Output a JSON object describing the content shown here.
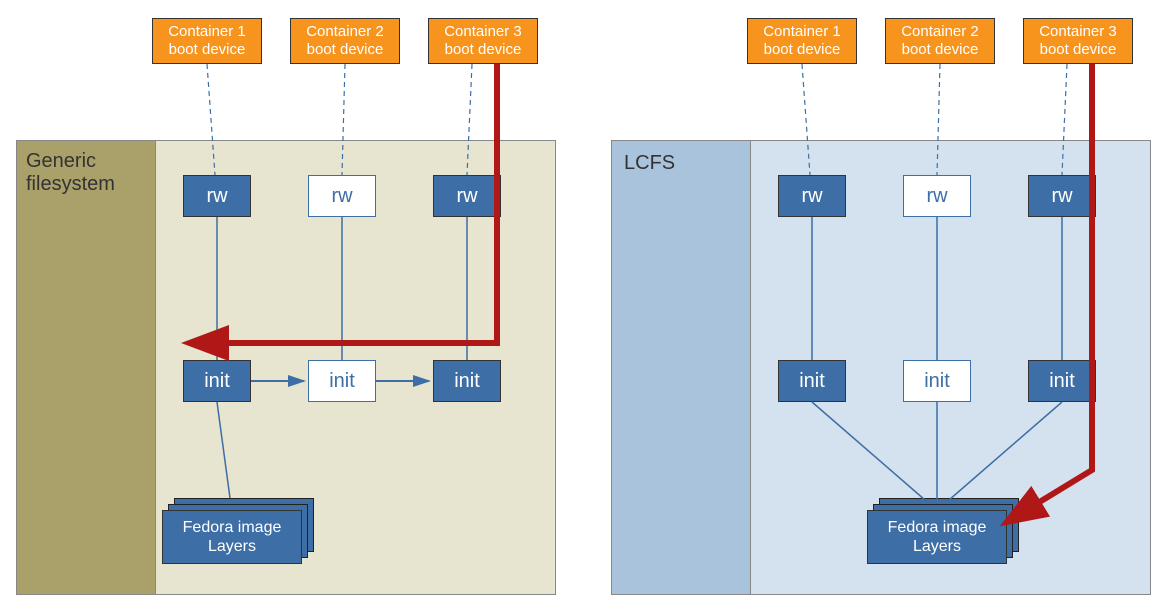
{
  "left": {
    "title": "Generic filesystem",
    "containers": [
      "Container 1 boot device",
      "Container 2 boot device",
      "Container 3 boot device"
    ],
    "rw": [
      "rw",
      "rw",
      "rw"
    ],
    "init": [
      "init",
      "init",
      "init"
    ],
    "fedora": "Fedora image Layers"
  },
  "right": {
    "title": "LCFS",
    "containers": [
      "Container 1 boot device",
      "Container 2 boot device",
      "Container 3 boot device"
    ],
    "rw": [
      "rw",
      "rw",
      "rw"
    ],
    "init": [
      "init",
      "init",
      "init"
    ],
    "fedora": "Fedora image Layers"
  },
  "colors": {
    "orange": "#f7941d",
    "blue": "#3d6ea5",
    "red": "#b01818",
    "left_outer": "#a9a06a",
    "left_inner": "#e7e4d0",
    "right_outer": "#a9c3dd",
    "right_inner": "#d4e1ee"
  }
}
